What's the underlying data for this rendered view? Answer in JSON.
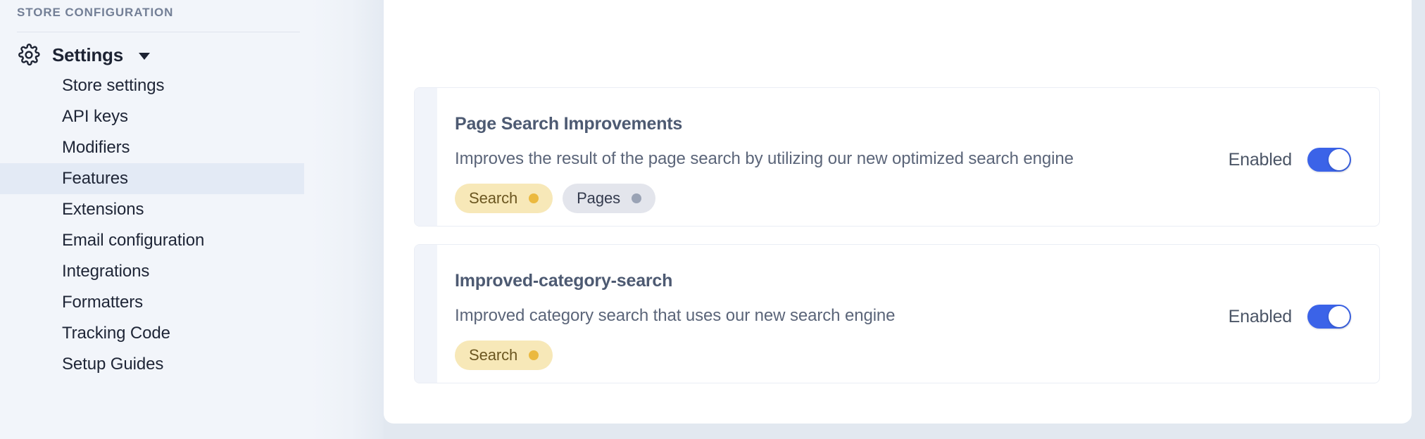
{
  "theme": {
    "sidebar_bg": "#f2f5fa",
    "panel_bg": "#ffffff",
    "page_bg": "#e2e8f0",
    "active_nav_bg": "#e3eaf5",
    "accent_blue": "#3b63e8",
    "tag_yellow_bg": "#f7e8b8",
    "tag_yellow_dot": "#ebb93f",
    "tag_gray_bg": "#e3e5ec",
    "tag_gray_dot": "#9aa3b5",
    "card_accent": "#f1f4fa"
  },
  "sidebar": {
    "section_label": "STORE CONFIGURATION",
    "settings": {
      "label": "Settings",
      "icon": "gear-icon",
      "chevron": "chevron-down-icon",
      "expanded": true
    },
    "items": [
      {
        "label": "Store settings",
        "active": false
      },
      {
        "label": "API keys",
        "active": false
      },
      {
        "label": "Modifiers",
        "active": false
      },
      {
        "label": "Features",
        "active": true
      },
      {
        "label": "Extensions",
        "active": false
      },
      {
        "label": "Email configuration",
        "active": false
      },
      {
        "label": "Integrations",
        "active": false
      },
      {
        "label": "Formatters",
        "active": false
      },
      {
        "label": "Tracking Code",
        "active": false
      },
      {
        "label": "Setup Guides",
        "active": false
      }
    ]
  },
  "main": {
    "feature_cards": [
      {
        "title": "Page Search Improvements",
        "description": "Improves the result of the page search by utilizing our new optimized search engine",
        "tags": [
          {
            "label": "Search",
            "variant": "search"
          },
          {
            "label": "Pages",
            "variant": "pages"
          }
        ],
        "toggle": {
          "label": "Enabled",
          "state": "on"
        }
      },
      {
        "title": "Improved-category-search",
        "description": "Improved category search that uses our new search engine",
        "tags": [
          {
            "label": "Search",
            "variant": "search"
          }
        ],
        "toggle": {
          "label": "Enabled",
          "state": "on"
        }
      }
    ]
  }
}
